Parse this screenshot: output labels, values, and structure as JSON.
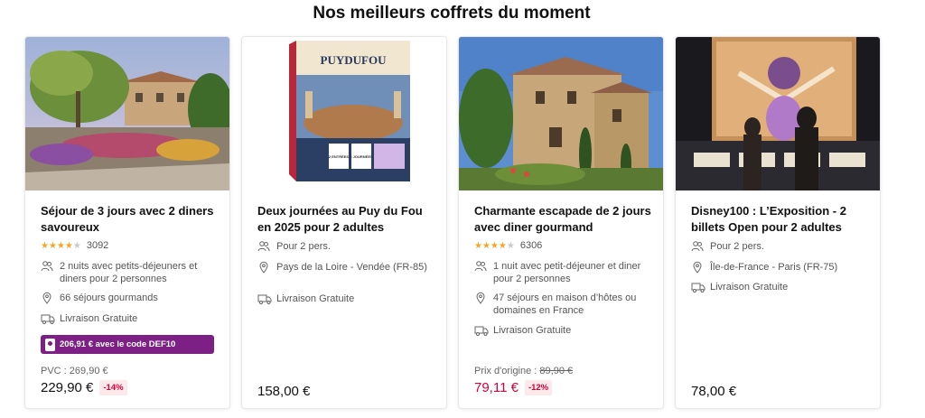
{
  "section": {
    "title": "Nos meilleurs coffrets du moment"
  },
  "colors": {
    "promo_bg": "#7d2085",
    "sale_red": "#d6003b",
    "star": "#f5a623"
  },
  "cards": [
    {
      "title": "Séjour de 3 jours avec 2 diners savoureux",
      "rating": {
        "stars": 4,
        "count": "3092"
      },
      "features": [
        {
          "icon": "people-icon",
          "text": "2 nuits avec petits-déjeuners et diners pour 2 personnes"
        },
        {
          "icon": "location-pin-icon",
          "text": "66 séjours gourmands"
        },
        {
          "icon": "truck-icon",
          "text": "Livraison Gratuite"
        }
      ],
      "promo": "206,91 € avec le code DEF10",
      "original_price_label": "PVC : 269,90 €",
      "price": "229,90 €",
      "discount": "-14%"
    },
    {
      "title": "Deux journées au Puy du Fou en 2025 pour 2 adultes",
      "features": [
        {
          "icon": "people-icon",
          "text": "Pour 2 pers."
        },
        {
          "icon": "location-pin-icon",
          "text": "Pays de la Loire - Vendée (FR-85)"
        },
        {
          "icon": "truck-icon",
          "text": "Livraison Gratuite"
        }
      ],
      "price": "158,00 €",
      "box_brand": "PUYDUFOU",
      "box_badges": [
        "2 ENTRÉES",
        "2 JOURNÉES"
      ]
    },
    {
      "title": "Charmante escapade de 2 jours avec diner gourmand",
      "rating": {
        "stars": 4,
        "count": "6306"
      },
      "features": [
        {
          "icon": "people-icon",
          "text": "1 nuit avec petit-déjeuner et diner pour 2 personnes"
        },
        {
          "icon": "location-pin-icon",
          "text": "47 séjours en maison d’hôtes ou domaines en France"
        },
        {
          "icon": "truck-icon",
          "text": "Livraison Gratuite"
        }
      ],
      "original_label": "Prix d'origine : ",
      "original_value": "89,90 €",
      "price": "79,11 €",
      "discount": "-12%"
    },
    {
      "title": "Disney100 : L’Exposition - 2 billets Open pour 2 adultes",
      "features": [
        {
          "icon": "people-icon",
          "text": "Pour 2 pers."
        },
        {
          "icon": "location-pin-icon",
          "text": "Île-de-France - Paris (FR-75)"
        },
        {
          "icon": "truck-icon",
          "text": "Livraison Gratuite"
        }
      ],
      "price": "78,00 €"
    }
  ]
}
